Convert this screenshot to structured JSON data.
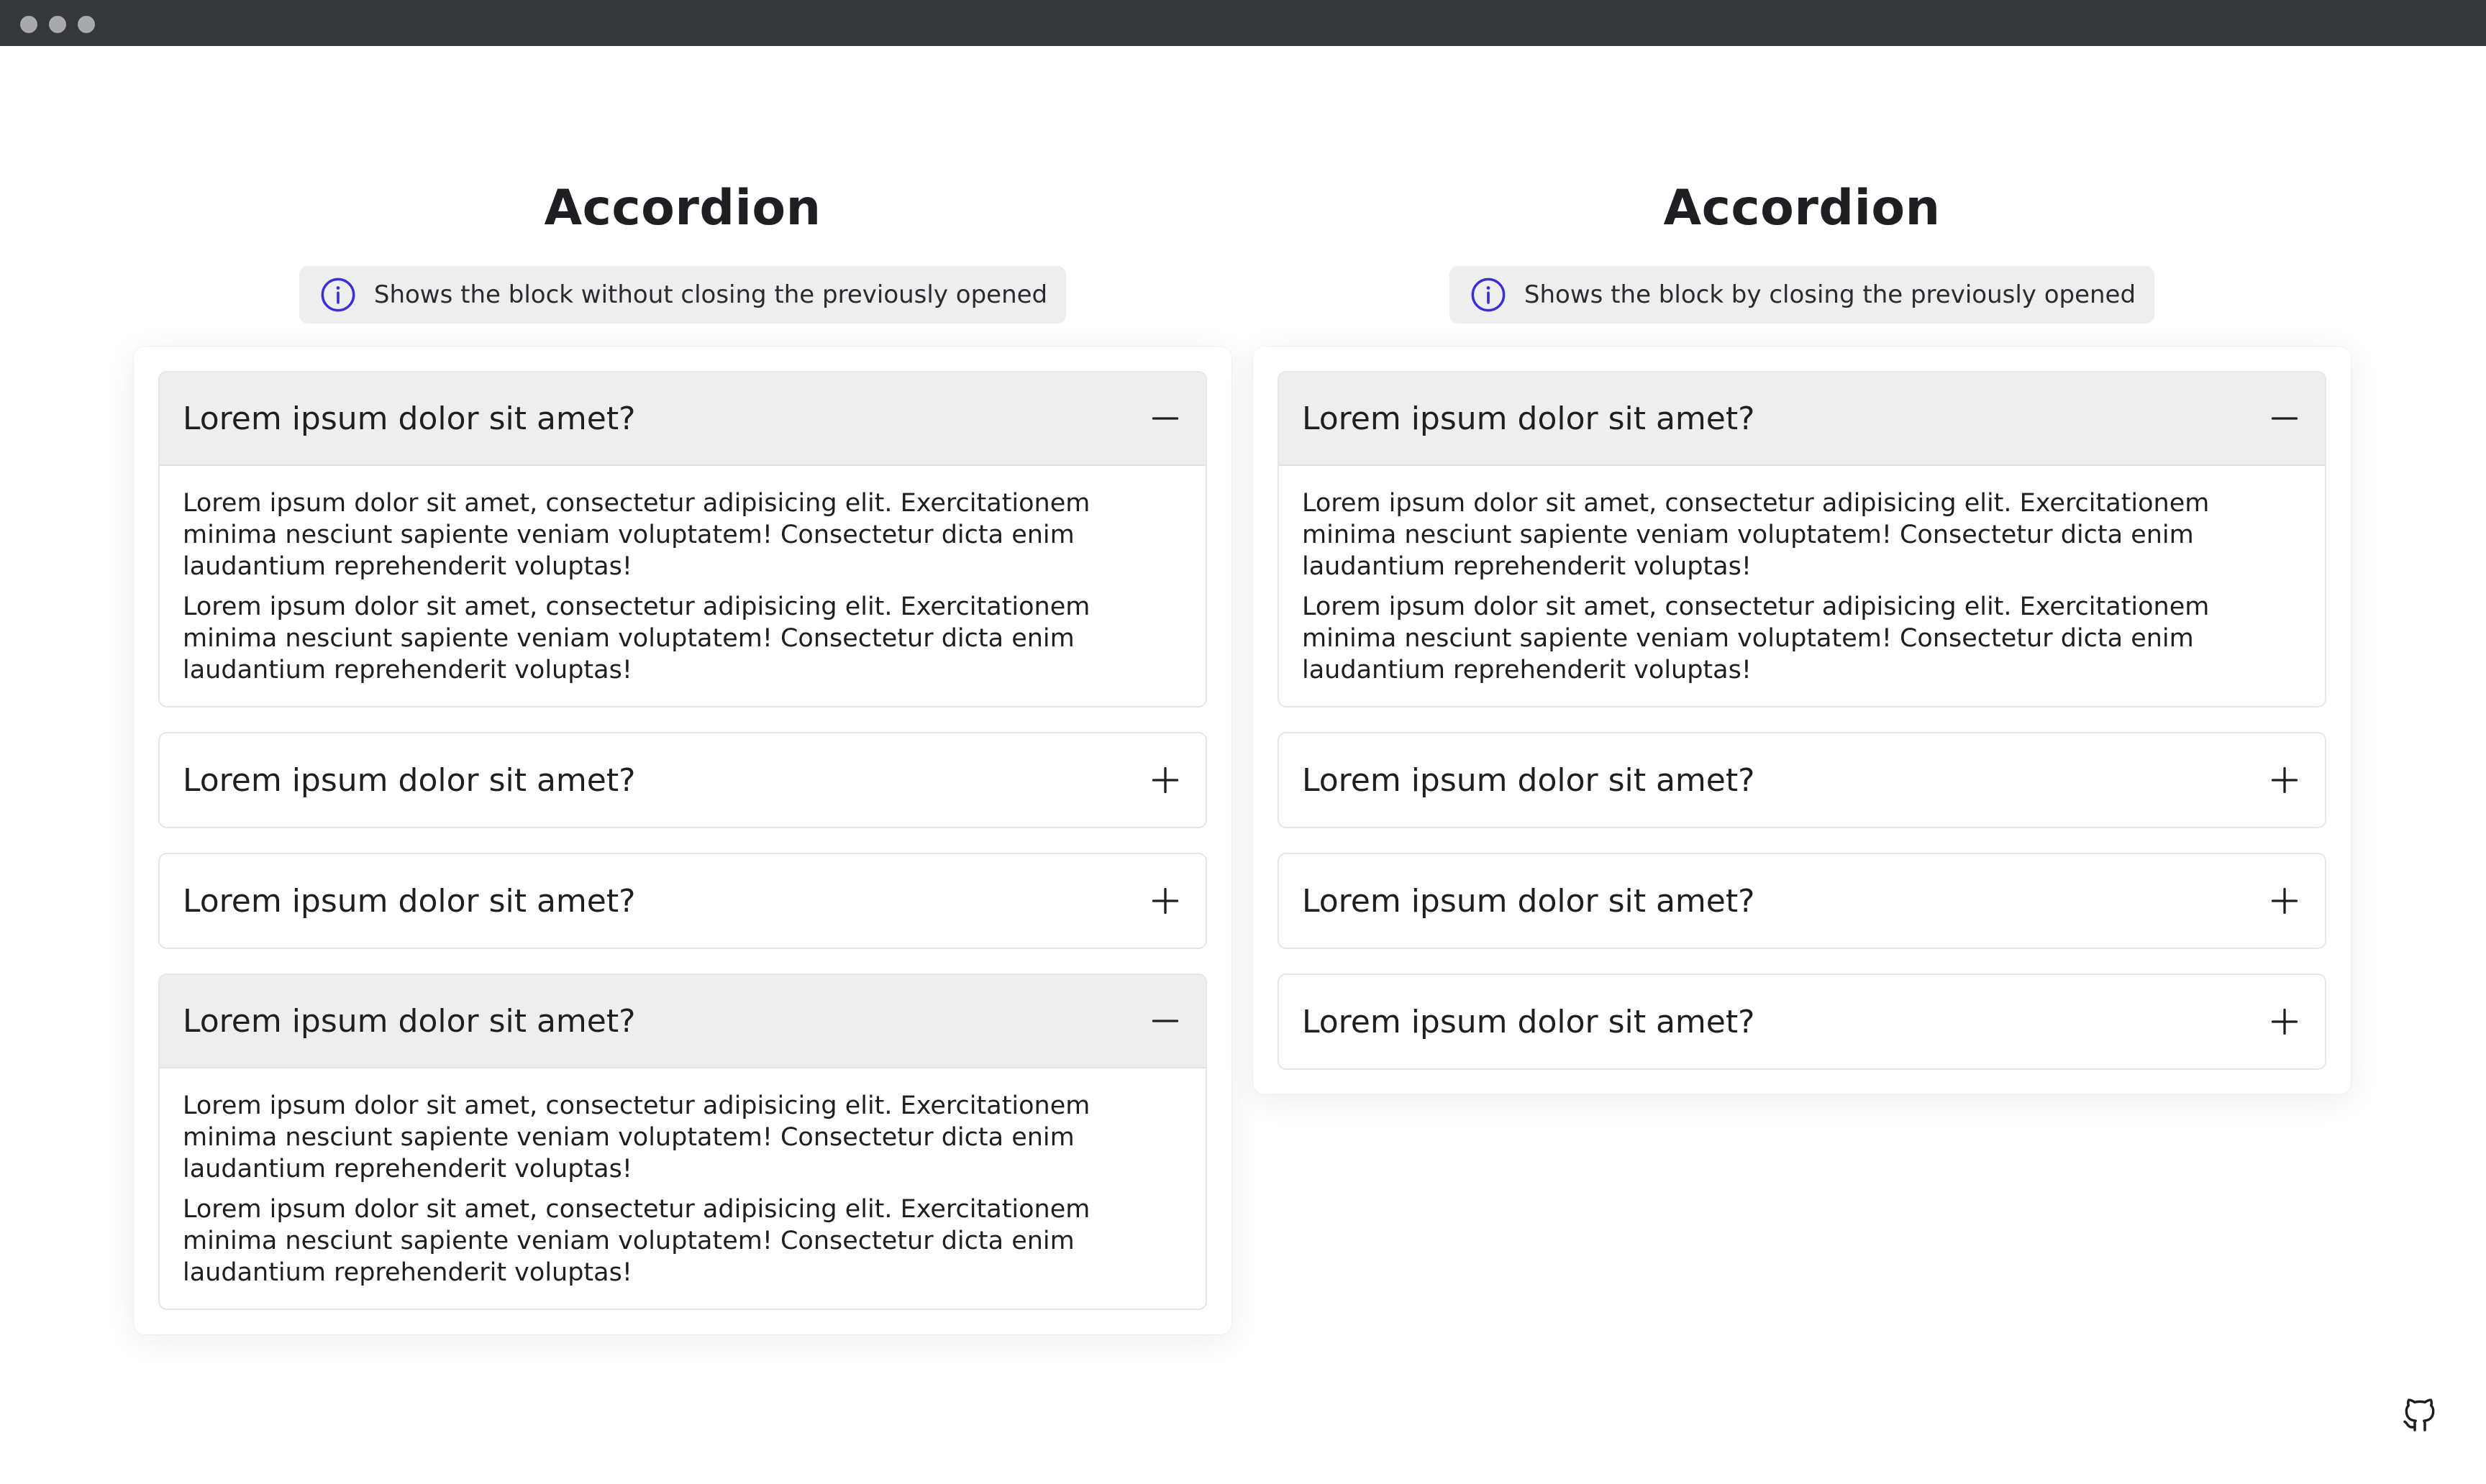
{
  "colors": {
    "titlebar": "#36373a",
    "window_dot": "#a9aaae",
    "info_icon": "#3b2fd6",
    "open_header_bg": "#eeeeee",
    "text": "#1f1f23"
  },
  "left": {
    "title": "Accordion",
    "info": {
      "icon": "info-circle-icon",
      "text": "Shows the block without closing the previously opened"
    },
    "items": [
      {
        "title": "Lorem ipsum dolor sit amet?",
        "open": true,
        "toggle": "minus-icon",
        "paragraphs": [
          "Lorem ipsum dolor sit amet, consectetur adipisicing elit. Exercitationem minima nesciunt sapiente veniam voluptatem! Consectetur dicta enim laudantium reprehenderit voluptas!",
          "Lorem ipsum dolor sit amet, consectetur adipisicing elit. Exercitationem minima nesciunt sapiente veniam voluptatem! Consectetur dicta enim laudantium reprehenderit voluptas!"
        ]
      },
      {
        "title": "Lorem ipsum dolor sit amet?",
        "open": false,
        "toggle": "plus-icon"
      },
      {
        "title": "Lorem ipsum dolor sit amet?",
        "open": false,
        "toggle": "plus-icon"
      },
      {
        "title": "Lorem ipsum dolor sit amet?",
        "open": true,
        "toggle": "minus-icon",
        "paragraphs": [
          "Lorem ipsum dolor sit amet, consectetur adipisicing elit. Exercitationem minima nesciunt sapiente veniam voluptatem! Consectetur dicta enim laudantium reprehenderit voluptas!",
          "Lorem ipsum dolor sit amet, consectetur adipisicing elit. Exercitationem minima nesciunt sapiente veniam voluptatem! Consectetur dicta enim laudantium reprehenderit voluptas!"
        ]
      }
    ]
  },
  "right": {
    "title": "Accordion",
    "info": {
      "icon": "info-circle-icon",
      "text": "Shows the block by closing the previously opened"
    },
    "items": [
      {
        "title": "Lorem ipsum dolor sit amet?",
        "open": true,
        "toggle": "minus-icon",
        "paragraphs": [
          "Lorem ipsum dolor sit amet, consectetur adipisicing elit. Exercitationem minima nesciunt sapiente veniam voluptatem! Consectetur dicta enim laudantium reprehenderit voluptas!",
          "Lorem ipsum dolor sit amet, consectetur adipisicing elit. Exercitationem minima nesciunt sapiente veniam voluptatem! Consectetur dicta enim laudantium reprehenderit voluptas!"
        ]
      },
      {
        "title": "Lorem ipsum dolor sit amet?",
        "open": false,
        "toggle": "plus-icon"
      },
      {
        "title": "Lorem ipsum dolor sit amet?",
        "open": false,
        "toggle": "plus-icon"
      },
      {
        "title": "Lorem ipsum dolor sit amet?",
        "open": false,
        "toggle": "plus-icon"
      }
    ]
  },
  "footer": {
    "icon": "github-icon"
  }
}
